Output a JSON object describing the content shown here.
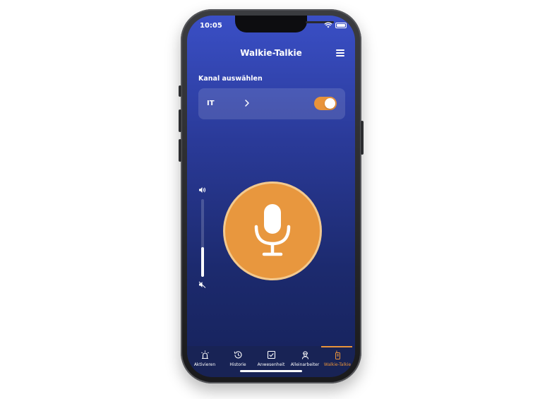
{
  "status_bar": {
    "time": "10:05"
  },
  "header": {
    "title": "Walkie-Talkie"
  },
  "channel": {
    "section_label": "Kanal auswählen",
    "name": "IT",
    "toggle_on": true
  },
  "volume": {
    "level_fraction": 0.38
  },
  "mic_button": {
    "icon": "microphone-icon"
  },
  "tabs": [
    {
      "label": "Aktivieren",
      "icon": "alarm-icon",
      "active": false
    },
    {
      "label": "Historie",
      "icon": "history-icon",
      "active": false
    },
    {
      "label": "Anwesenheit",
      "icon": "checkbox-icon",
      "active": false
    },
    {
      "label": "Alleinarbeiter",
      "icon": "worker-icon",
      "active": false
    },
    {
      "label": "Walkie-Talkie",
      "icon": "walkie-talkie-icon",
      "active": true
    }
  ],
  "colors": {
    "accent": "#e8933a",
    "background_top": "#3a4fc6",
    "background_bottom": "#16225a",
    "tabbar": "#182355"
  }
}
